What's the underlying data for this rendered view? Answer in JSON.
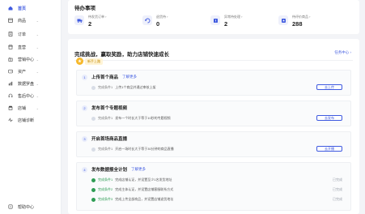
{
  "sidebar": {
    "items": [
      {
        "label": "首页",
        "active": true,
        "icon": "home-icon"
      },
      {
        "label": "商品",
        "active": false,
        "icon": "box-icon"
      },
      {
        "label": "订单",
        "active": false,
        "icon": "order-icon"
      },
      {
        "label": "直营",
        "active": false,
        "icon": "store-icon"
      },
      {
        "label": "营销中心",
        "active": false,
        "icon": "gift-icon"
      },
      {
        "label": "资产",
        "active": false,
        "icon": "wallet-icon"
      },
      {
        "label": "数据罗盘",
        "active": false,
        "icon": "chart-icon"
      },
      {
        "label": "售后中心",
        "active": false,
        "icon": "headset-icon"
      },
      {
        "label": "店铺",
        "active": false,
        "icon": "shop-icon"
      },
      {
        "label": "店铺诊断",
        "active": false,
        "icon": "pulse-icon"
      }
    ],
    "help_label": "帮助中心"
  },
  "todo": {
    "title": "待办事项",
    "items": [
      {
        "label": "待发货订单 ›",
        "value": "2",
        "icon": "truck-icon"
      },
      {
        "label": "退货待 ›",
        "value": "0",
        "icon": "return-icon"
      },
      {
        "label": "异常待处理 ›",
        "value": "2",
        "icon": "warning-icon"
      },
      {
        "label": "待评价商品 ›",
        "value": "288",
        "icon": "star-icon"
      }
    ]
  },
  "tasks": {
    "title": "完成挑战，赢取奖励，助力店铺快速成长",
    "link": "任务中心 ›",
    "badge": "新手上路",
    "list": [
      {
        "num": "1",
        "name": "上传首个商品",
        "more": "了解更多",
        "conditions": [
          {
            "tag": "完成条件1",
            "text": "上传1个商品并通过审核上架",
            "done": false
          }
        ],
        "action": "去上传"
      },
      {
        "num": "2",
        "name": "发布首个专题视频",
        "more": "",
        "conditions": [
          {
            "tag": "完成条件1",
            "text": "发布一个时长大于等于10秒的专题视频",
            "done": false
          }
        ],
        "action": "去发布"
      },
      {
        "num": "3",
        "name": "开启首场商品直播",
        "more": "",
        "conditions": [
          {
            "tag": "完成条件1",
            "text": "开启一场时长大于等于30分钟的商品直播",
            "done": false
          }
        ],
        "action": "去开播"
      },
      {
        "num": "4",
        "name": "发布数据报全计划",
        "more": "了解更多",
        "conditions": [
          {
            "tag": "完成条件1",
            "text": "完成店铺认证，并设置至少1名发货地址",
            "done": true
          },
          {
            "tag": "完成条件2",
            "text": "完成主体认证，并设置店铺客服联系方式",
            "done": true
          },
          {
            "tag": "完成条件3",
            "text": "完成上传全部商品，并设置店铺退货地址",
            "done": true
          }
        ],
        "done_label": "已完成"
      }
    ]
  },
  "colors": {
    "accent": "#3f5ae0",
    "success": "#2f9d55",
    "badge": "#f6b82a"
  }
}
